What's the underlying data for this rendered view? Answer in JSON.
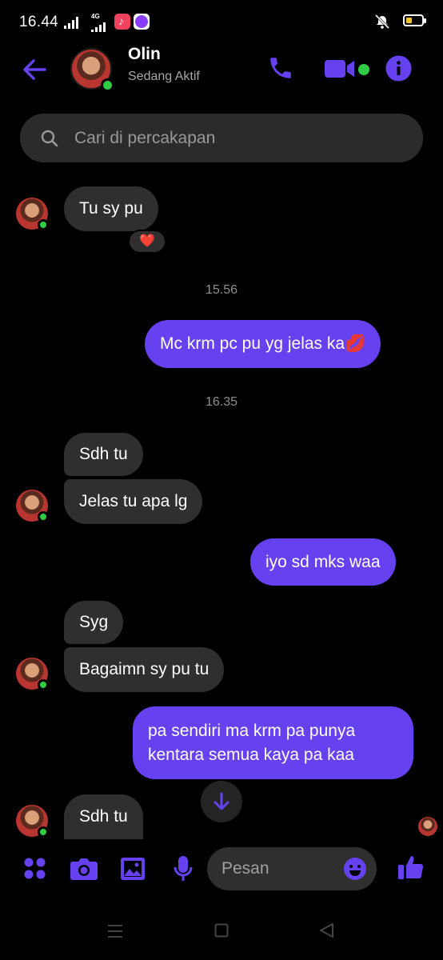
{
  "status_bar": {
    "time": "16.44",
    "network_label": "4G",
    "battery_level_percent": 30,
    "music_badge_color": "#f0425c",
    "messenger_badge_color": "#8a3cff"
  },
  "header": {
    "contact_name": "Olin",
    "status": "Sedang Aktif",
    "accent": "#6641f0"
  },
  "search": {
    "placeholder": "Cari di percakapan"
  },
  "messages": {
    "m1": "Tu sy pu",
    "m1_reaction": "❤️",
    "ts1": "15.56",
    "m2": "Mc krm pc pu yg jelas ka💋",
    "ts2": "16.35",
    "m3": "Sdh  tu",
    "m4": "Jelas tu apa lg",
    "m5": "iyo sd mks waa",
    "m6": "Syg",
    "m7": "Bagaimn sy pu tu",
    "m8_line1": "pa sendiri ma krm pa punya",
    "m8_line2": "kentara semua kaya pa kaa",
    "m9": "Sdh tu"
  },
  "composer": {
    "placeholder": "Pesan"
  },
  "icons": [
    "back-arrow-icon",
    "phone-icon",
    "video-icon",
    "info-icon",
    "search-icon",
    "apps-icon",
    "camera-icon",
    "gallery-icon",
    "mic-icon",
    "emoji-icon",
    "like-icon",
    "scroll-down-icon"
  ]
}
